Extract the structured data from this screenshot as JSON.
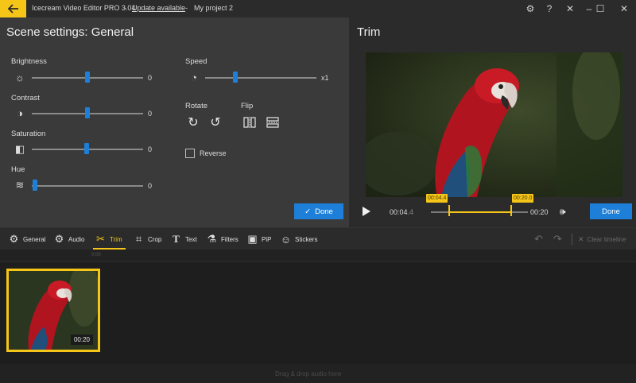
{
  "titlebar": {
    "app_title": "Icecream Video Editor PRO 3.04",
    "separator1": "-",
    "update_link": "Update available",
    "separator2": "-",
    "project_name": "My project 2",
    "icons": [
      "back-arrow-icon",
      "settings-gear-icon",
      "help-icon",
      "close-icon",
      "minimize-icon",
      "maximize-icon",
      "window-close-icon"
    ]
  },
  "scene_settings": {
    "title": "Scene settings: General",
    "brightness": {
      "label": "Brightness",
      "value": "0",
      "level": 0.5
    },
    "contrast": {
      "label": "Contrast",
      "value": "0",
      "level": 0.5
    },
    "saturation": {
      "label": "Saturation",
      "value": "0",
      "level": 0.5
    },
    "hue": {
      "label": "Hue",
      "value": "0",
      "level": 0.0
    },
    "speed": {
      "label": "Speed",
      "value": "x1",
      "level": 0.27
    },
    "rotate_label": "Rotate",
    "flip_label": "Flip",
    "reverse_label": "Reverse",
    "reverse_checked": false,
    "done_label": "Done"
  },
  "trim": {
    "title": "Trim",
    "current_time": "00:04",
    "current_time_fraction": ".4",
    "start_tag": "00:04.4",
    "end_tag": "00:20.0",
    "end_time": "00:20",
    "done_label": "Done"
  },
  "toolbar": {
    "tools": [
      {
        "label": "General",
        "icon": "gear-icon"
      },
      {
        "label": "Audio",
        "icon": "audio-gear-icon"
      },
      {
        "label": "Trim",
        "icon": "scissors-icon"
      },
      {
        "label": "Crop",
        "icon": "crop-icon"
      },
      {
        "label": "Text",
        "icon": "text-icon"
      },
      {
        "label": "Filters",
        "icon": "filters-icon"
      },
      {
        "label": "PiP",
        "icon": "pip-icon"
      },
      {
        "label": "Stickers",
        "icon": "stickers-icon"
      }
    ],
    "active_tool": "Trim",
    "clear_timeline_label": "Clear timeline"
  },
  "timeline": {
    "ruler_mark": "0:00",
    "clip_duration": "00:20",
    "audio_hint": "Drag & drop audio here"
  },
  "colors": {
    "accent_yellow": "#f5c518",
    "accent_blue": "#1e7fd8",
    "panel_bg": "#3a3a3a",
    "app_bg": "#2b2b2b"
  }
}
